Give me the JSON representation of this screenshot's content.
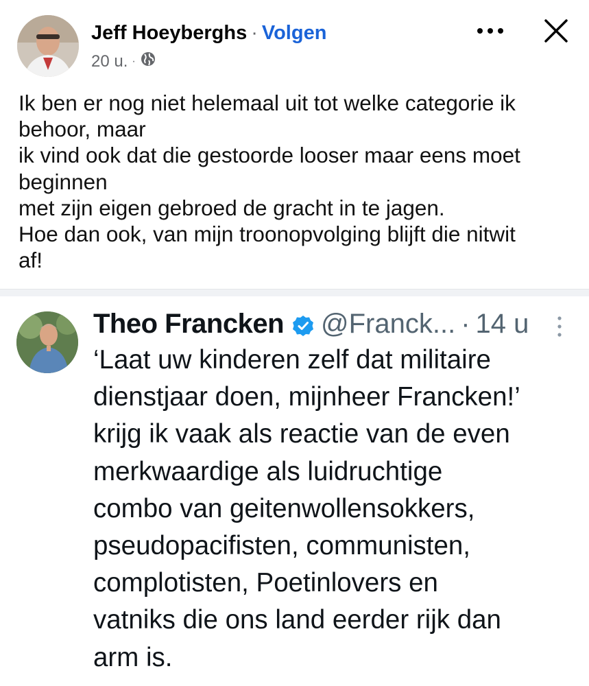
{
  "post": {
    "author": "Jeff Hoeyberghs",
    "separator": "·",
    "follow_label": "Volgen",
    "timestamp": "20 u.",
    "meta_dot": "·",
    "audience_icon": "globe-icon",
    "more_icon": "more-dots-icon",
    "close_icon": "close-icon",
    "text_lines": [
      "Ik ben er nog niet helemaal uit tot welke categorie ik",
      "behoor, maar",
      "ik vind ook dat die gestoorde looser maar eens moet",
      "beginnen",
      "met zijn eigen gebroed de gracht in te jagen.",
      "Hoe dan ook, van mijn troonopvolging blijft die nitwit",
      "af!"
    ]
  },
  "tweet": {
    "name": "Theo Francken",
    "verified_icon": "verified-badge-icon",
    "handle": "@Franck...",
    "dot": "·",
    "time": "14 u",
    "menu_icon": "vertical-dots-icon",
    "text_lines": [
      "‘Laat uw kinderen zelf dat militaire",
      "dienstjaar doen, mijnheer Francken!’",
      "krijg ik vaak als reactie van de even",
      "merkwaardige als luidruchtige",
      "combo van geitenwollensokkers,",
      "pseudopacifisten, communisten,",
      "complotisten, Poetinlovers en",
      "vatniks die ons land eerder rijk dan",
      "arm is."
    ]
  },
  "colors": {
    "follow": "#1a63d8",
    "muted": "#65676b",
    "verified": "#1d9bf0",
    "divider": "#f0f2f5"
  }
}
